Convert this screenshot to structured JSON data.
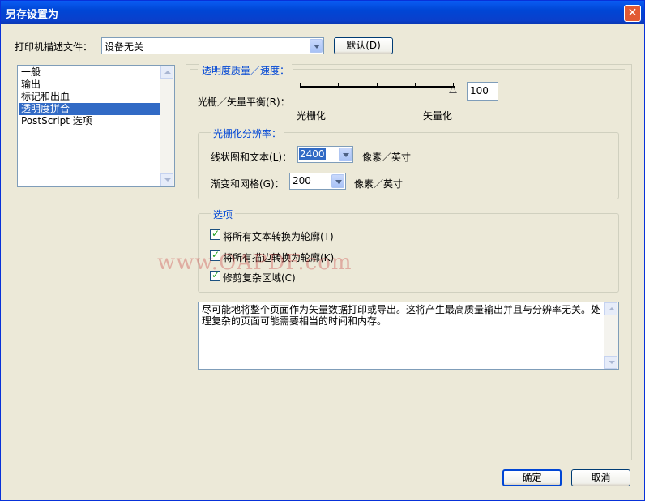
{
  "window": {
    "title": "另存设置为",
    "close_glyph": "✕"
  },
  "printer_desc": {
    "label": "打印机描述文件：",
    "value": "设备无关",
    "default_button": "默认(D)"
  },
  "categories": [
    {
      "label": "一般",
      "selected": false
    },
    {
      "label": "输出",
      "selected": false
    },
    {
      "label": "标记和出血",
      "selected": false
    },
    {
      "label": "透明度拼合",
      "selected": true
    },
    {
      "label": "PostScript 选项",
      "selected": false
    }
  ],
  "transparency": {
    "legend": "透明度质量／速度：",
    "slider_label": "光栅／矢量平衡(R)：",
    "slider_value": "100",
    "left_caption": "光栅化",
    "right_caption": "矢量化"
  },
  "raster_resolution": {
    "legend": "光栅化分辨率：",
    "line_art_label": "线状图和文本(L)：",
    "line_art_value": "2400",
    "line_art_unit": "像素／英寸",
    "gradient_label": "渐变和网格(G)：",
    "gradient_value": "200",
    "gradient_unit": "像素／英寸"
  },
  "options": {
    "legend": "选项",
    "items": [
      {
        "label": "将所有文本转换为轮廓(T)",
        "checked": true
      },
      {
        "label": "将所有描边转换为轮廓(K)",
        "checked": true
      },
      {
        "label": "修剪复杂区域(C)",
        "checked": true
      }
    ]
  },
  "description": "尽可能地将整个页面作为矢量数据打印或导出。这将产生最高质量输出并且与分辨率无关。处理复杂的页面可能需要相当的时间和内存。",
  "watermark": "www.OAPDF.com",
  "buttons": {
    "ok": "确定",
    "cancel": "取消"
  },
  "colors": {
    "titlebar": "#0054e3",
    "selection": "#316ac5",
    "legend": "#0046d5",
    "background": "#ece9d8"
  }
}
